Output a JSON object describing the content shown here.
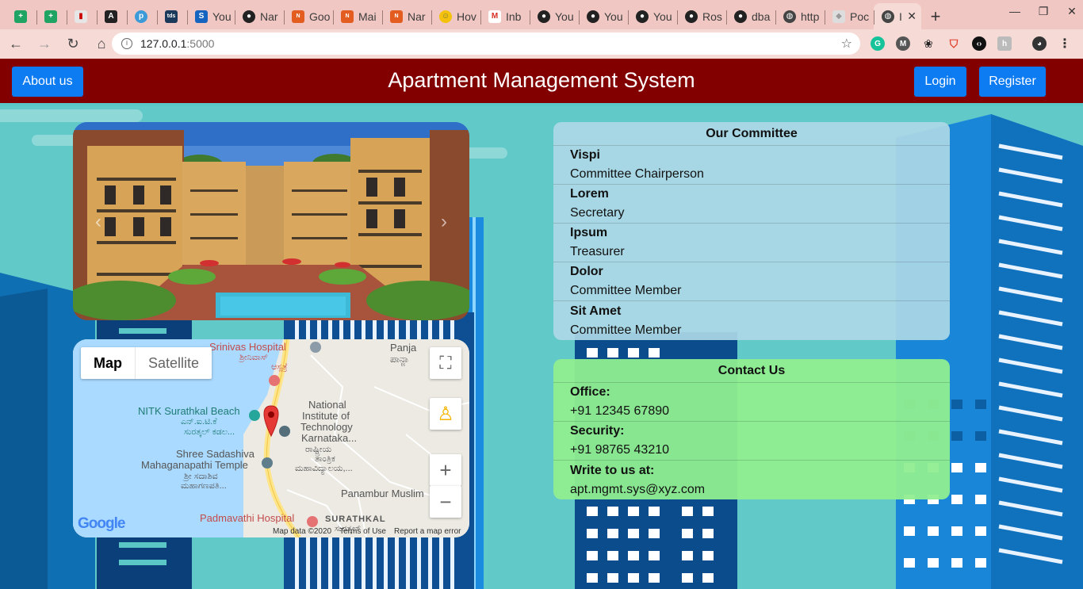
{
  "browser": {
    "tabs": [
      {
        "title": "",
        "favicon_color": "#1fa463",
        "favicon_glyph": "+"
      },
      {
        "title": "",
        "favicon_color": "#1fa463",
        "favicon_glyph": "+"
      },
      {
        "title": "",
        "favicon_color": "#e6e6e6",
        "favicon_glyph": "▮"
      },
      {
        "title": "",
        "favicon_color": "#222222",
        "favicon_glyph": "A"
      },
      {
        "title": "",
        "favicon_color": "#3d9ad8",
        "favicon_glyph": "p"
      },
      {
        "title": "",
        "favicon_color": "#1b3a5b",
        "favicon_glyph": "tds"
      },
      {
        "title": "You",
        "favicon_color": "#1565c0",
        "favicon_glyph": "S"
      },
      {
        "title": "Nar",
        "favicon_color": "#222222",
        "favicon_glyph": "●"
      },
      {
        "title": "Goo",
        "favicon_color": "#e25d1f",
        "favicon_glyph": "N"
      },
      {
        "title": "Mai",
        "favicon_color": "#e25d1f",
        "favicon_glyph": "N"
      },
      {
        "title": "Nar",
        "favicon_color": "#e25d1f",
        "favicon_glyph": "N"
      },
      {
        "title": "Hov",
        "favicon_color": "#f4c20d",
        "favicon_glyph": "☺"
      },
      {
        "title": "Inb",
        "favicon_color": "#d93025",
        "favicon_glyph": "M"
      },
      {
        "title": "You",
        "favicon_color": "#222222",
        "favicon_glyph": "●"
      },
      {
        "title": "You",
        "favicon_color": "#222222",
        "favicon_glyph": "●"
      },
      {
        "title": "You",
        "favicon_color": "#222222",
        "favicon_glyph": "●"
      },
      {
        "title": "Ros",
        "favicon_color": "#222222",
        "favicon_glyph": "●"
      },
      {
        "title": "dba",
        "favicon_color": "#222222",
        "favicon_glyph": "●"
      },
      {
        "title": "http",
        "favicon_color": "#444444",
        "favicon_glyph": "◍"
      },
      {
        "title": "Poc",
        "favicon_color": "#dddddd",
        "favicon_glyph": "◆"
      }
    ],
    "active_tab": {
      "title": "I",
      "favicon_glyph": "◍"
    },
    "new_tab_label": "+",
    "address": {
      "host": "127.0.0.1",
      "port": ":5000"
    }
  },
  "header": {
    "about_label": "About us",
    "title": "Apartment Management System",
    "login_label": "Login",
    "register_label": "Register"
  },
  "carousel": {
    "prev": "‹",
    "next": "›"
  },
  "map": {
    "type_map": "Map",
    "type_satellite": "Satellite",
    "labels": [
      "Srinivas Hospital",
      "ಶ್ರೀನಿವಾಸ್",
      "ಆಸ್ಪತ್ರೆ",
      "Panja",
      "ಪಾನ್ಜಾ",
      "NITK Surathkal Beach",
      "ಎನ್.ಐ.ಟಿ.ಕೆ",
      "ಸುರತ್ಕಲ್ ಕಡಲ...",
      "National",
      "Institute of",
      "Technology",
      "Karnataka...",
      "ರಾಷ್ಟ್ರೀಯ",
      "ತಾಂತ್ರಿಕ",
      "ಮಹಾವಿದ್ಯಾಲಯ,...",
      "Shree Sadashiva",
      "Mahaganapathi Temple",
      "ಶ್ರೀ ಸದಾಶಿವ",
      "ಮಹಾಗಣಪತಿ...",
      "Panambur Muslim",
      "Padmavathi Hospital",
      "SURATHKAL",
      "ಸುರತ್ಕಲ್"
    ],
    "footer": {
      "data": "Map data ©2020",
      "terms": "Terms of Use",
      "report": "Report a map error"
    },
    "logo": "Google"
  },
  "committee": {
    "title": "Our Committee",
    "members": [
      {
        "name": "Vispi",
        "role": "Committee Chairperson"
      },
      {
        "name": "Lorem",
        "role": "Secretary"
      },
      {
        "name": "Ipsum",
        "role": "Treasurer"
      },
      {
        "name": "Dolor",
        "role": "Committee Member"
      },
      {
        "name": "Sit Amet",
        "role": "Committee Member"
      }
    ]
  },
  "contact": {
    "title": "Contact Us",
    "rows": [
      {
        "label": "Office:",
        "value": "+91 12345 67890"
      },
      {
        "label": "Security:",
        "value": "+91 98765 43210"
      },
      {
        "label": "Write to us at:",
        "value": "apt.mgmt.sys@xyz.com"
      }
    ]
  },
  "colors": {
    "header_bg": "#820000",
    "button_blue": "#0d7bf2",
    "committee_bg": "#add8e6",
    "contact_bg": "#90ee90",
    "page_bg": "#5bc6c6"
  }
}
